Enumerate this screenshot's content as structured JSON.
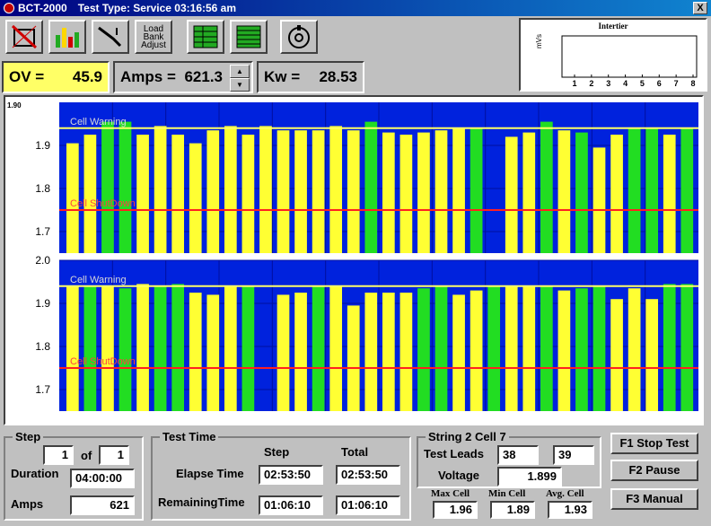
{
  "window": {
    "title": "BCT-2000",
    "subtitle": "Test Type: Service 03:16:56 am",
    "close_label": "X"
  },
  "toolbar": {
    "load_bank_label": "Load Bank Adjust"
  },
  "readouts": {
    "ov_label": "OV =",
    "ov_value": "45.9",
    "amps_label": "Amps =",
    "amps_value": "621.3",
    "kw_label": "Kw =",
    "kw_value": "28.53",
    "spin_up": "▲",
    "spin_down": "▼"
  },
  "intertier": {
    "title": "Intertier",
    "ylabel": "mVs",
    "x_ticks": [
      "1",
      "2",
      "3",
      "4",
      "5",
      "6",
      "7",
      "8"
    ]
  },
  "chart_data": {
    "type": "bar",
    "top_axis_label": "1.90",
    "warning_label": "Cell Warning",
    "shutdown_label": "Cell ShutDown",
    "warning_level": 1.94,
    "shutdown_level": 1.75,
    "colors": {
      "background": "#0022dd",
      "yellow": "#ffff33",
      "green": "#22dd22",
      "warning": "#ffff66",
      "shutdown": "#ff2020"
    },
    "panels": [
      {
        "ylim": [
          1.65,
          2.0
        ],
        "y_ticks": [
          "1.9",
          "1.8",
          "1.7"
        ],
        "values": [
          1.905,
          1.925,
          1.955,
          1.955,
          1.925,
          1.945,
          1.925,
          1.905,
          1.935,
          1.945,
          1.925,
          1.945,
          1.935,
          1.935,
          1.935,
          1.945,
          1.935,
          1.955,
          1.93,
          1.925,
          1.93,
          1.935,
          1.94,
          1.94,
          null,
          1.92,
          1.93,
          1.955,
          1.935,
          1.93,
          1.895,
          1.925,
          1.94,
          1.94,
          1.925,
          1.94
        ],
        "colors": [
          "y",
          "y",
          "g",
          "g",
          "y",
          "y",
          "y",
          "y",
          "y",
          "y",
          "y",
          "y",
          "y",
          "y",
          "y",
          "y",
          "y",
          "g",
          "y",
          "y",
          "y",
          "y",
          "y",
          "g",
          null,
          "y",
          "y",
          "g",
          "y",
          "g",
          "y",
          "y",
          "g",
          "g",
          "y",
          "g"
        ]
      },
      {
        "ylim": [
          1.65,
          2.0
        ],
        "y_ticks": [
          "2.0",
          "1.9",
          "1.8",
          "1.7"
        ],
        "values": [
          1.94,
          1.94,
          1.94,
          1.935,
          1.945,
          1.94,
          1.945,
          1.925,
          1.92,
          1.94,
          1.94,
          null,
          1.92,
          1.925,
          1.94,
          1.94,
          1.895,
          1.925,
          1.925,
          1.925,
          1.935,
          1.94,
          1.92,
          1.93,
          1.94,
          1.94,
          1.94,
          1.94,
          1.93,
          1.935,
          1.94,
          1.91,
          1.935,
          1.91,
          1.945,
          1.945
        ],
        "colors": [
          "y",
          "g",
          "y",
          "g",
          "y",
          "g",
          "g",
          "y",
          "y",
          "y",
          "g",
          null,
          "y",
          "y",
          "g",
          "y",
          "y",
          "y",
          "y",
          "y",
          "g",
          "g",
          "y",
          "y",
          "g",
          "y",
          "y",
          "g",
          "y",
          "g",
          "g",
          "y",
          "y",
          "y",
          "g",
          "g"
        ]
      }
    ]
  },
  "step_panel": {
    "title": "Step",
    "step_value": "1",
    "of_label": "of",
    "of_value": "1",
    "duration_label": "Duration",
    "duration_value": "04:00:00",
    "amps_label": "Amps",
    "amps_value": "621"
  },
  "test_time": {
    "title": "Test Time",
    "step_header": "Step",
    "total_header": "Total",
    "elapse_label": "Elapse Time",
    "elapse_step": "02:53:50",
    "elapse_total": "02:53:50",
    "remaining_label": "RemainingTime",
    "remaining_step": "01:06:10",
    "remaining_total": "01:06:10"
  },
  "string_panel": {
    "title": "String 2 Cell 7",
    "test_leads_label": "Test Leads",
    "lead_1": "38",
    "lead_2": "39",
    "voltage_label": "Voltage",
    "voltage_value": "1.899",
    "max_label": "Max Cell",
    "max_value": "1.96",
    "min_label": "Min Cell",
    "min_value": "1.89",
    "avg_label": "Avg. Cell",
    "avg_value": "1.93"
  },
  "buttons": {
    "f1": "F1 Stop Test",
    "f2": "F2 Pause",
    "f3": "F3 Manual"
  }
}
